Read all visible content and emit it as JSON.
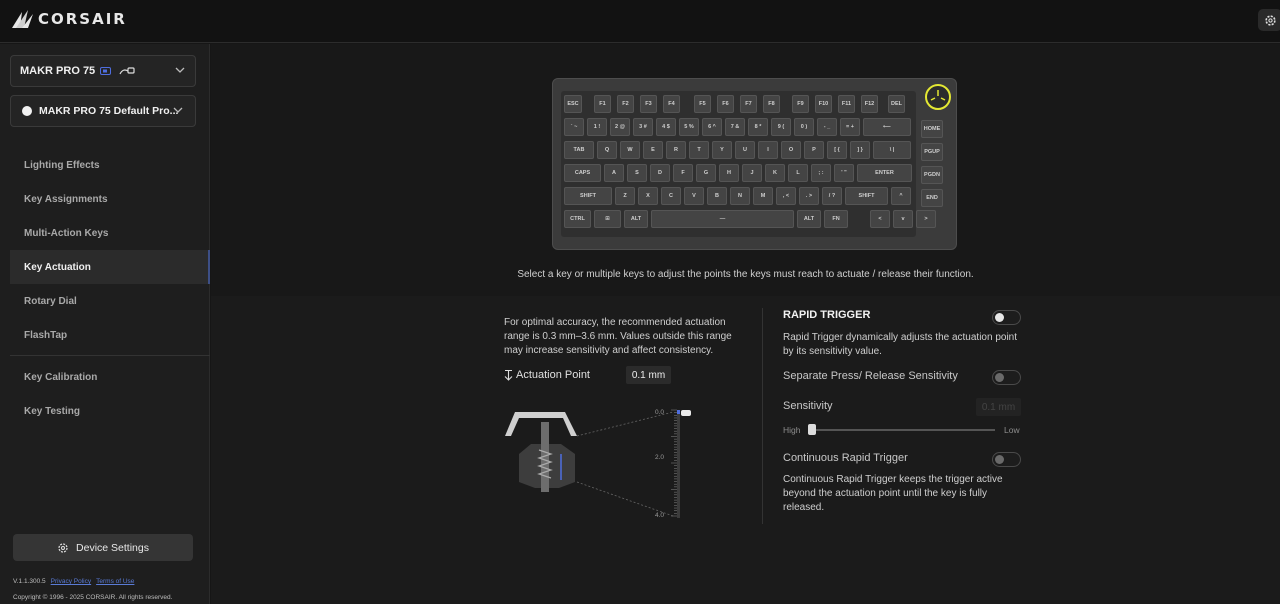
{
  "app": {
    "brand": "CORSAIR"
  },
  "sidebar": {
    "device": "MAKR PRO 75",
    "profile": "MAKR PRO 75 Default Pro...",
    "items": [
      {
        "label": "Lighting Effects"
      },
      {
        "label": "Key Assignments"
      },
      {
        "label": "Multi-Action Keys"
      },
      {
        "label": "Key Actuation"
      },
      {
        "label": "Rotary Dial"
      },
      {
        "label": "FlashTap"
      },
      {
        "label": "Key Calibration"
      },
      {
        "label": "Key Testing"
      }
    ],
    "active_item": "Key Actuation",
    "device_settings_label": "Device Settings",
    "version": "V.1.1.300.5",
    "privacy": "Privacy Policy",
    "terms": "Terms of Use",
    "copyright": "Copyright © 1996 - 2025 CORSAIR. All rights reserved."
  },
  "keyboard": {
    "rows": [
      [
        "ESC",
        "F1",
        "F2",
        "F3",
        "F4",
        "F5",
        "F6",
        "F7",
        "F8",
        "F9",
        "F10",
        "F11",
        "F12",
        "DEL"
      ],
      [
        "` ~",
        "1 !",
        "2 @",
        "3 #",
        "4 $",
        "5 %",
        "6 ^",
        "7 &",
        "8 *",
        "9 (",
        "0 )",
        "- _",
        "= +",
        "⟵",
        "HOME"
      ],
      [
        "TAB",
        "Q",
        "W",
        "E",
        "R",
        "T",
        "Y",
        "U",
        "I",
        "O",
        "P",
        "[ {",
        "] }",
        "\\ |",
        "PGUP"
      ],
      [
        "CAPS",
        "A",
        "S",
        "D",
        "F",
        "G",
        "H",
        "J",
        "K",
        "L",
        "; :",
        "' \"",
        "ENTER",
        "PGDN"
      ],
      [
        "SHIFT",
        "Z",
        "X",
        "C",
        "V",
        "B",
        "N",
        "M",
        ", <",
        ". >",
        "/ ?",
        "SHIFT",
        "^",
        "END"
      ],
      [
        "CTRL",
        "⊞",
        "ALT",
        "—",
        "ALT",
        "FN",
        "<",
        "v",
        ">"
      ]
    ],
    "knob_color": "#e4e833"
  },
  "main": {
    "hint": "Select a key or multiple keys to adjust the points the keys must reach to actuate / release their function.",
    "info": "For optimal accuracy, the recommended actuation range is 0.3 mm–3.6 mm. Values outside this range may increase sensitivity and affect consistency.",
    "actuation_label": "Actuation Point",
    "actuation_value": "0.1 mm",
    "scale": [
      "0.0",
      "2.0",
      "4.0"
    ],
    "rapid_trigger": {
      "title": "RAPID TRIGGER",
      "enabled": false,
      "desc": "Rapid Trigger dynamically adjusts the actuation point by its sensitivity value.",
      "separate_label": "Separate Press/ Release Sensitivity",
      "separate_enabled": false,
      "sensitivity_label": "Sensitivity",
      "sensitivity_value": "0.1 mm",
      "slider_position": 0,
      "high_label": "High",
      "low_label": "Low",
      "continuous_label": "Continuous Rapid Trigger",
      "continuous_enabled": false,
      "continuous_desc": "Continuous Rapid Trigger keeps the trigger active beyond the actuation point until the key is fully released."
    }
  }
}
